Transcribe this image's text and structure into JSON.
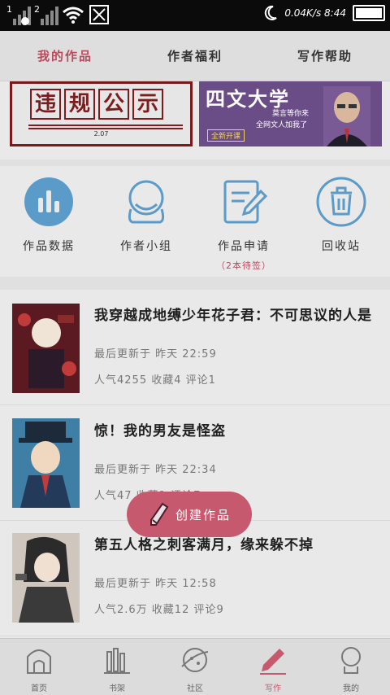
{
  "status_bar": {
    "sim1": "1",
    "sim2": "2",
    "net_speed": "0.04K/s",
    "time": "8:44"
  },
  "tabs": [
    {
      "label": "我的作品",
      "active": true
    },
    {
      "label": "作者福利",
      "active": false
    },
    {
      "label": "写作帮助",
      "active": false
    }
  ],
  "banners": {
    "left": {
      "chars": [
        "违",
        "规",
        "公",
        "示"
      ],
      "date": "2.07"
    },
    "right": {
      "title": "四文大学",
      "line1": "莫言等你来",
      "line2": "全网文人加我了",
      "tag": "全新开课"
    }
  },
  "quick_actions": [
    {
      "label": "作品数据",
      "icon": "bar-chart-icon"
    },
    {
      "label": "作者小组",
      "icon": "group-icon"
    },
    {
      "label": "作品申请",
      "icon": "edit-document-icon",
      "note": "（2本待签）"
    },
    {
      "label": "回收站",
      "icon": "trash-icon"
    }
  ],
  "works": [
    {
      "title": "我穿越成地缚少年花子君：不可思议的人是",
      "updated": "最后更新于 昨天 22:59",
      "stats": "人气4255 收藏4 评论1"
    },
    {
      "title": "惊！我的男友是怪盗",
      "updated": "最后更新于 昨天 22:34",
      "stats": "人气47 收藏1 评论7"
    },
    {
      "title": "第五人格之刺客满月，缘来躲不掉",
      "updated": "最后更新于 昨天 12:58",
      "stats": "人气2.6万 收藏12 评论9"
    }
  ],
  "fab": {
    "label": "创建作品"
  },
  "bottom_nav": [
    {
      "label": "首页",
      "icon": "home-icon",
      "active": false
    },
    {
      "label": "书架",
      "icon": "bookshelf-icon",
      "active": false
    },
    {
      "label": "社区",
      "icon": "community-icon",
      "active": false
    },
    {
      "label": "写作",
      "icon": "pen-icon",
      "active": true
    },
    {
      "label": "我的",
      "icon": "profile-icon",
      "active": false
    }
  ],
  "colors": {
    "accent": "#c6596d",
    "icon_blue": "#5a9bc9"
  }
}
